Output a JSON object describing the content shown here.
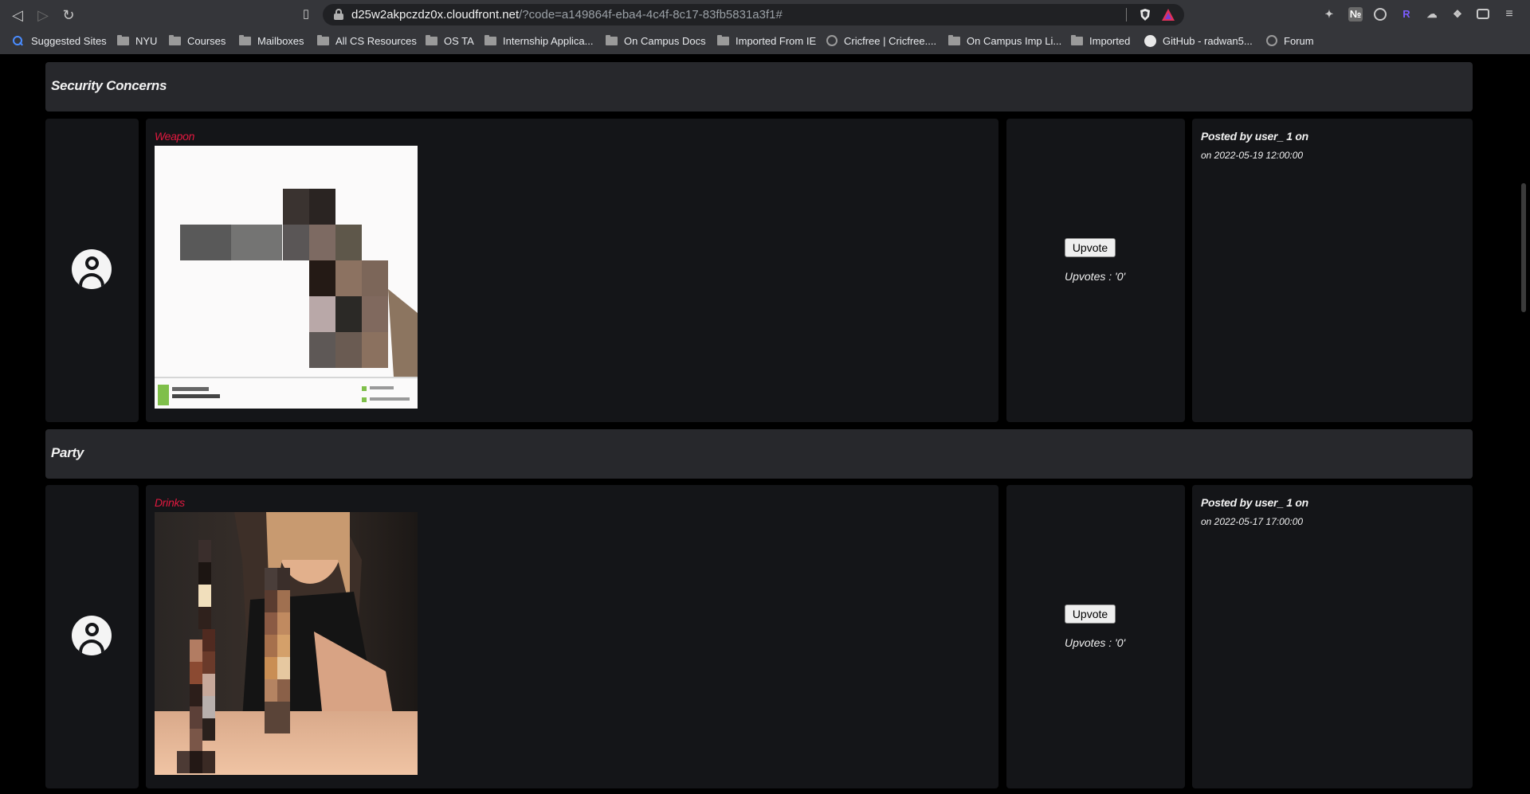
{
  "browser": {
    "url_host": "d25w2akpczdz0x.cloudfront.net",
    "url_path": "/?code=a149864f-eba4-4c4f-8c17-83fb5831a3f1#",
    "extension_r_label": "R",
    "bookmarks": [
      {
        "label": "Suggested Sites",
        "icon": "search-icon"
      },
      {
        "label": "NYU",
        "icon": "folder-icon"
      },
      {
        "label": "Courses",
        "icon": "folder-icon"
      },
      {
        "label": "Mailboxes",
        "icon": "folder-icon"
      },
      {
        "label": "All CS Resources",
        "icon": "folder-icon"
      },
      {
        "label": "OS TA",
        "icon": "folder-icon"
      },
      {
        "label": "Internship Applica...",
        "icon": "folder-icon"
      },
      {
        "label": "On Campus Docs",
        "icon": "folder-icon"
      },
      {
        "label": "Imported From IE",
        "icon": "folder-icon"
      },
      {
        "label": "Cricfree | Cricfree....",
        "icon": "globe-icon"
      },
      {
        "label": "On Campus Imp Li...",
        "icon": "folder-icon"
      },
      {
        "label": "Imported",
        "icon": "folder-icon"
      },
      {
        "label": "GitHub - radwan5...",
        "icon": "github-icon"
      },
      {
        "label": "Forum",
        "icon": "globe-icon"
      }
    ]
  },
  "sections": [
    {
      "category": "Security Concerns",
      "post": {
        "title": "Weapon",
        "image_alt": "pixelated weapon image",
        "upvote_label": "Upvote",
        "upvotes_text": "Upvotes : '0'",
        "posted_by": "Posted by user_ 1 on",
        "posted_on": "on 2022-05-19 12:00:00"
      }
    },
    {
      "category": "Party",
      "post": {
        "title": "Drinks",
        "image_alt": "pixelated drinks image",
        "upvote_label": "Upvote",
        "upvotes_text": "Upvotes : '0'",
        "posted_by": "Posted by user_ 1 on",
        "posted_on": "on 2022-05-17 17:00:00"
      }
    }
  ],
  "colors": {
    "post_title": "#e0193f",
    "panel_bg": "#141518",
    "header_bg": "#27282c"
  }
}
